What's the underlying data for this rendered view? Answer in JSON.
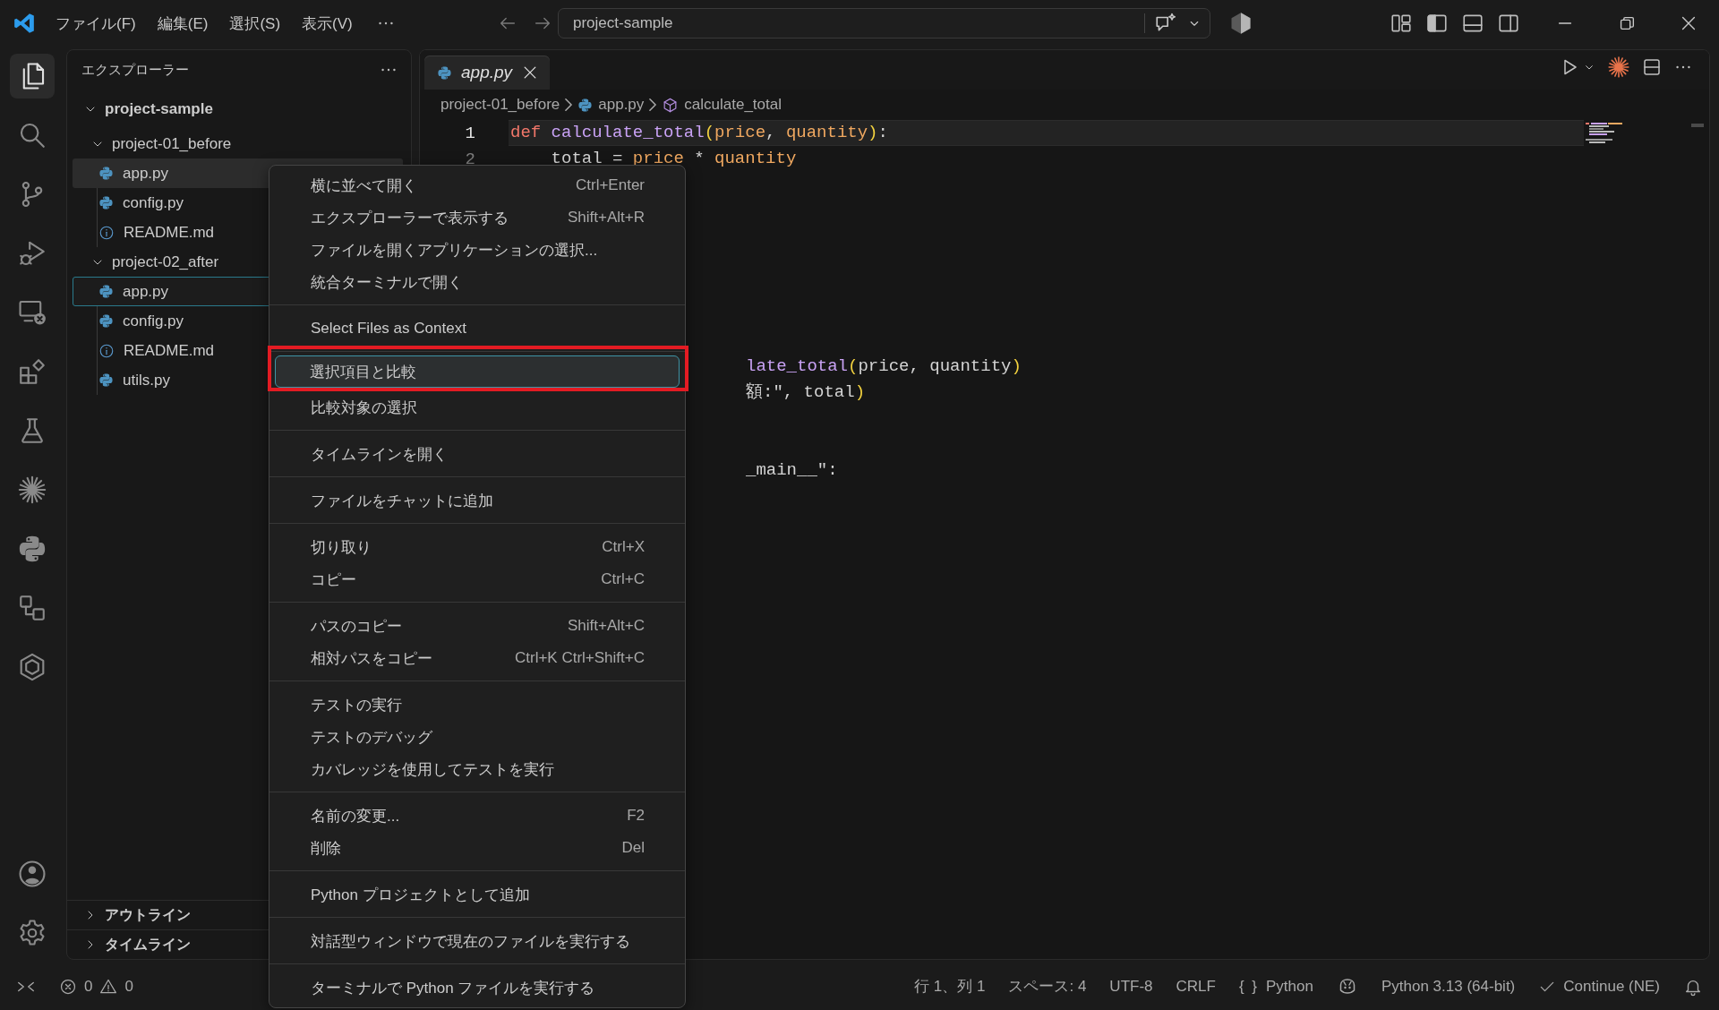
{
  "title_bar": {
    "menus": [
      "ファイル(F)",
      "編集(E)",
      "選択(S)",
      "表示(V)"
    ],
    "command_center": "project-sample",
    "layout_toggles": [
      {
        "kind": "panels",
        "on": false
      },
      {
        "kind": "primary_sidebar",
        "on": true
      },
      {
        "kind": "panel",
        "on": false
      },
      {
        "kind": "secondary_sidebar",
        "on": false
      }
    ]
  },
  "activity_bar": {
    "items": [
      {
        "kind": "explorer",
        "selected": true
      },
      {
        "kind": "search",
        "selected": false
      },
      {
        "kind": "source_control",
        "selected": false
      },
      {
        "kind": "run_debug",
        "selected": false
      },
      {
        "kind": "remote",
        "selected": false
      },
      {
        "kind": "extensions",
        "selected": false
      },
      {
        "kind": "testing",
        "selected": false
      },
      {
        "kind": "sparkle",
        "selected": false
      },
      {
        "kind": "python",
        "selected": false
      },
      {
        "kind": "diagram",
        "selected": false
      },
      {
        "kind": "hexagon",
        "selected": false
      }
    ],
    "bottom": [
      {
        "kind": "account"
      },
      {
        "kind": "settings"
      }
    ]
  },
  "sidebar": {
    "title": "エクスプローラー",
    "tree": {
      "label": "project-sample",
      "kind": "folder",
      "expanded": true,
      "selected": false,
      "focused": false,
      "children": [
        {
          "label": "project-01_before",
          "kind": "folder",
          "expanded": true,
          "selected": false,
          "focused": false,
          "children": [
            {
              "label": "app.py",
              "kind": "python",
              "selected": true,
              "focused": false
            },
            {
              "label": "config.py",
              "kind": "python",
              "selected": false,
              "focused": false
            },
            {
              "label": "README.md",
              "kind": "markdown",
              "selected": false,
              "focused": false
            }
          ]
        },
        {
          "label": "project-02_after",
          "kind": "folder",
          "expanded": true,
          "selected": false,
          "focused": false,
          "children": [
            {
              "label": "app.py",
              "kind": "python",
              "selected": false,
              "focused": true
            },
            {
              "label": "config.py",
              "kind": "python",
              "selected": false,
              "focused": false
            },
            {
              "label": "README.md",
              "kind": "markdown",
              "selected": false,
              "focused": false
            },
            {
              "label": "utils.py",
              "kind": "python",
              "selected": false,
              "focused": false
            }
          ]
        }
      ]
    },
    "sections": [
      {
        "label": "アウトライン",
        "expanded": false
      },
      {
        "label": "タイムライン",
        "expanded": false
      }
    ]
  },
  "editor": {
    "tabs": [
      {
        "label": "app.py",
        "kind": "python",
        "selected": true,
        "preview": true
      }
    ],
    "breadcrumbs": [
      {
        "label": "project-01_before",
        "kind": "folder"
      },
      {
        "label": "app.py",
        "kind": "python"
      },
      {
        "label": "calculate_total",
        "kind": "function"
      }
    ],
    "lines": [
      {
        "kind": "full",
        "number": "1",
        "current": true,
        "tokens": [
          {
            "text": "def ",
            "kind": "keyword"
          },
          {
            "text": "calculate_total",
            "kind": "function"
          },
          {
            "text": "(",
            "kind": "paren"
          },
          {
            "text": "price",
            "kind": "param"
          },
          {
            "text": ", ",
            "kind": "plain"
          },
          {
            "text": "quantity",
            "kind": "param"
          },
          {
            "text": ")",
            "kind": "paren"
          },
          {
            "text": ":",
            "kind": "plain"
          }
        ]
      },
      {
        "kind": "full",
        "number": "2",
        "current": false,
        "tokens": [
          {
            "text": "    total = ",
            "kind": "plain"
          },
          {
            "text": "price",
            "kind": "param"
          },
          {
            "text": " * ",
            "kind": "plain"
          },
          {
            "text": "quantity",
            "kind": "param"
          }
        ]
      },
      {
        "kind": "hidden"
      },
      {
        "kind": "hidden"
      },
      {
        "kind": "hidden"
      },
      {
        "kind": "hidden"
      },
      {
        "kind": "hidden"
      },
      {
        "kind": "hidden"
      },
      {
        "kind": "hidden"
      },
      {
        "kind": "fragment",
        "tokens": [
          {
            "text": "late_total",
            "kind": "function"
          },
          {
            "text": "(",
            "kind": "paren"
          },
          {
            "text": "price, quantity",
            "kind": "plain"
          },
          {
            "text": ")",
            "kind": "paren"
          }
        ]
      },
      {
        "kind": "fragment",
        "tokens": [
          {
            "text": "額:\", total",
            "kind": "plain"
          },
          {
            "text": ")",
            "kind": "paren"
          }
        ]
      },
      {
        "kind": "hidden"
      },
      {
        "kind": "hidden"
      },
      {
        "kind": "fragment",
        "tokens": [
          {
            "text": "_main__\":",
            "kind": "plain"
          }
        ]
      }
    ]
  },
  "context_menu": {
    "groups": [
      [
        {
          "label": "横に並べて開く",
          "shortcut": "Ctrl+Enter",
          "selected": false,
          "marked": false
        },
        {
          "label": "エクスプローラーで表示する",
          "shortcut": "Shift+Alt+R",
          "selected": false,
          "marked": false
        },
        {
          "label": "ファイルを開くアプリケーションの選択...",
          "selected": false,
          "marked": false
        },
        {
          "label": "統合ターミナルで開く",
          "selected": false,
          "marked": false
        }
      ],
      [
        {
          "label": "Select Files as Context",
          "selected": false,
          "marked": false
        }
      ],
      [
        {
          "label": "選択項目と比較",
          "selected": true,
          "marked": true
        },
        {
          "label": "比較対象の選択",
          "selected": false,
          "marked": false
        }
      ],
      [
        {
          "label": "タイムラインを開く",
          "selected": false,
          "marked": false
        }
      ],
      [
        {
          "label": "ファイルをチャットに追加",
          "selected": false,
          "marked": false
        }
      ],
      [
        {
          "label": "切り取り",
          "shortcut": "Ctrl+X",
          "selected": false,
          "marked": false
        },
        {
          "label": "コピー",
          "shortcut": "Ctrl+C",
          "selected": false,
          "marked": false
        }
      ],
      [
        {
          "label": "パスのコピー",
          "shortcut": "Shift+Alt+C",
          "selected": false,
          "marked": false
        },
        {
          "label": "相対パスをコピー",
          "shortcut": "Ctrl+K Ctrl+Shift+C",
          "selected": false,
          "marked": false
        }
      ],
      [
        {
          "label": "テストの実行",
          "selected": false,
          "marked": false
        },
        {
          "label": "テストのデバッグ",
          "selected": false,
          "marked": false
        },
        {
          "label": "カバレッジを使用してテストを実行",
          "selected": false,
          "marked": false
        }
      ],
      [
        {
          "label": "名前の変更...",
          "shortcut": "F2",
          "selected": false,
          "marked": false
        },
        {
          "label": "削除",
          "shortcut": "Del",
          "selected": false,
          "marked": false
        }
      ],
      [
        {
          "label": "Python プロジェクトとして追加",
          "selected": false,
          "marked": false
        }
      ],
      [
        {
          "label": "対話型ウィンドウで現在のファイルを実行する",
          "selected": false,
          "marked": false
        }
      ],
      [
        {
          "label": "ターミナルで Python ファイルを実行する",
          "selected": false,
          "marked": false
        }
      ]
    ]
  },
  "status_bar": {
    "errors": "0",
    "warnings": "0",
    "items": [
      {
        "kind": "text",
        "label": "行 1、列 1"
      },
      {
        "kind": "text",
        "label": "スペース: 4"
      },
      {
        "kind": "text",
        "label": "UTF-8"
      },
      {
        "kind": "text",
        "label": "CRLF"
      },
      {
        "kind": "language",
        "glyph": "{ }",
        "label": "Python"
      },
      {
        "kind": "copilot"
      },
      {
        "kind": "text",
        "label": "Python 3.13 (64-bit)"
      },
      {
        "kind": "check",
        "label": "Continue (NE)"
      },
      {
        "kind": "bell"
      }
    ]
  }
}
